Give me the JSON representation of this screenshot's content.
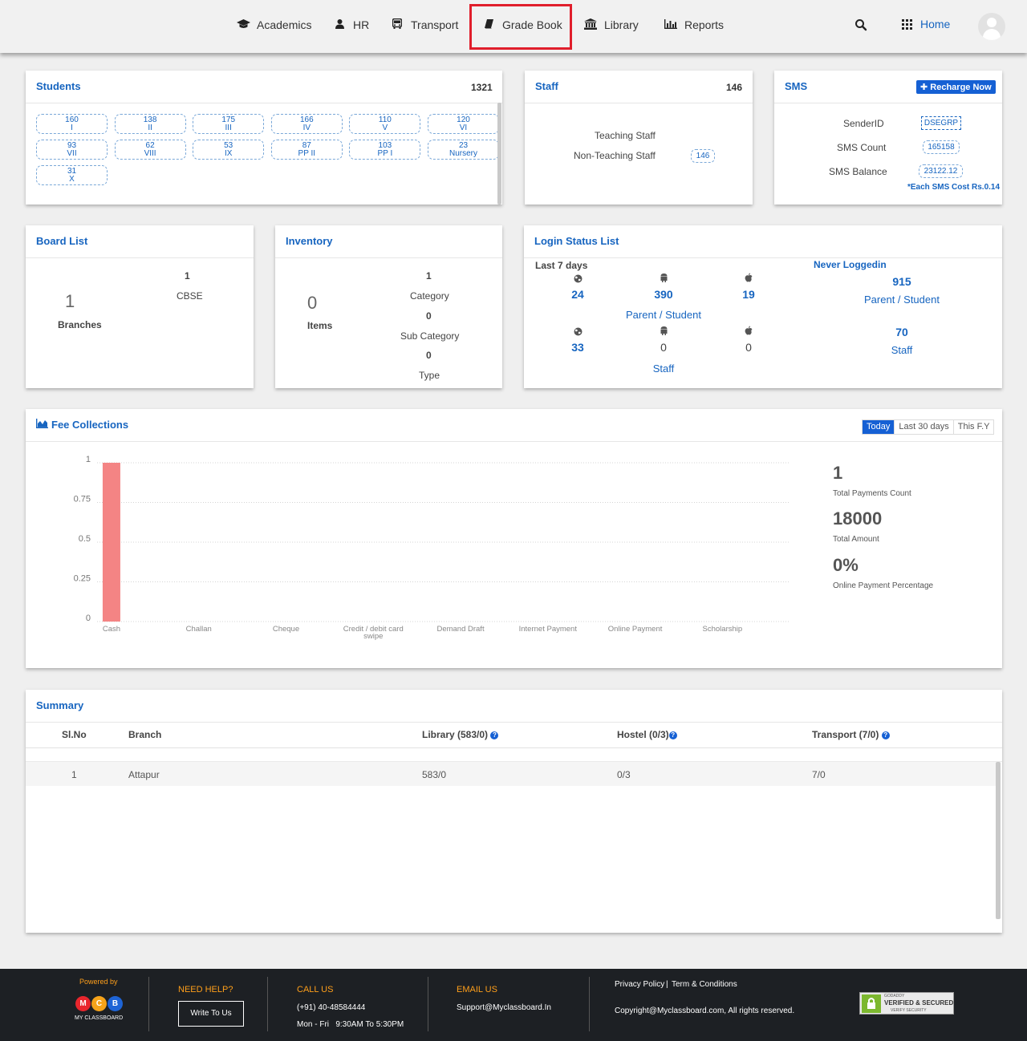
{
  "nav": {
    "items": [
      {
        "label": "Academics",
        "icon": "graduation-cap-icon"
      },
      {
        "label": "HR",
        "icon": "user-icon"
      },
      {
        "label": "Transport",
        "icon": "bus-icon"
      },
      {
        "label": "Grade Book",
        "icon": "book-icon"
      },
      {
        "label": "Library",
        "icon": "institution-icon"
      },
      {
        "label": "Reports",
        "icon": "bar-chart-icon"
      }
    ],
    "home_label": "Home",
    "highlight_color": "#e01e2b"
  },
  "students": {
    "title": "Students",
    "total": "1321",
    "classes": [
      {
        "count": "160",
        "name": "I"
      },
      {
        "count": "138",
        "name": "II"
      },
      {
        "count": "175",
        "name": "III"
      },
      {
        "count": "166",
        "name": "IV"
      },
      {
        "count": "110",
        "name": "V"
      },
      {
        "count": "120",
        "name": "VI"
      },
      {
        "count": "93",
        "name": "VII"
      },
      {
        "count": "62",
        "name": "VIII"
      },
      {
        "count": "53",
        "name": "IX"
      },
      {
        "count": "87",
        "name": "PP II"
      },
      {
        "count": "103",
        "name": "PP I"
      },
      {
        "count": "23",
        "name": "Nursery"
      },
      {
        "count": "31",
        "name": "X"
      }
    ]
  },
  "staff": {
    "title": "Staff",
    "total": "146",
    "teaching_label": "Teaching Staff",
    "non_teaching_label": "Non-Teaching Staff",
    "non_teaching_count": "146"
  },
  "sms": {
    "title": "SMS",
    "recharge_label": "Recharge Now",
    "sender_label": "SenderID",
    "sender_value": "DSEGRP",
    "count_label": "SMS Count",
    "count_value": "165158",
    "balance_label": "SMS Balance",
    "balance_value": "23122.12",
    "cost_note": "*Each SMS Cost Rs.0.14"
  },
  "board": {
    "title": "Board List",
    "branches_value": "1",
    "branches_label": "Branches",
    "cbse_value": "1",
    "cbse_label": "CBSE"
  },
  "inventory": {
    "title": "Inventory",
    "items_value": "0",
    "items_label": "Items",
    "category_value": "1",
    "category_label": "Category",
    "subcategory_value": "0",
    "subcategory_label": "Sub Category",
    "type_value": "0",
    "type_label": "Type"
  },
  "login": {
    "title": "Login Status List",
    "last7_label": "Last 7 days",
    "parent_web": "24",
    "parent_android": "390",
    "parent_ios": "19",
    "parent_label": "Parent / Student",
    "staff_web": "33",
    "staff_android": "0",
    "staff_ios": "0",
    "staff_label": "Staff",
    "never_label": "Never Loggedin",
    "never_parent_value": "915",
    "never_parent_label": "Parent / Student",
    "never_staff_value": "70",
    "never_staff_label": "Staff"
  },
  "fees": {
    "title": "Fee Collections",
    "tabs": [
      "Today",
      "Last 30 days",
      "This F.Y"
    ],
    "payments_count": "1",
    "payments_count_label": "Total Payments Count",
    "total_amount": "18000",
    "total_amount_label": "Total Amount",
    "online_pct": "0%",
    "online_pct_label": "Online Payment Percentage"
  },
  "chart_data": {
    "type": "bar",
    "categories": [
      "Cash",
      "Challan",
      "Cheque",
      "Credit / debit card swipe",
      "Demand Draft",
      "Internet Payment",
      "Online Payment",
      "Scholarship"
    ],
    "values": [
      1,
      0,
      0,
      0,
      0,
      0,
      0,
      0
    ],
    "yticks": [
      "0",
      "0.25",
      "0.5",
      "0.75",
      "1"
    ],
    "ylim": [
      0,
      1
    ],
    "bar_color": "#f48484",
    "grid": true
  },
  "summary": {
    "title": "Summary",
    "columns": [
      "Sl.No",
      "Branch",
      "Library (583/0)",
      "Hostel (0/3)",
      "Transport (7/0)"
    ],
    "rows": [
      {
        "slno": "1",
        "branch": "Attapur",
        "library": "583/0",
        "hostel": "0/3",
        "transport": "7/0"
      }
    ]
  },
  "footer": {
    "powered_by": "Powered by",
    "brand": "MY CLASSBOARD",
    "need_help": "NEED HELP?",
    "write_label": "Write To Us",
    "call_us": "CALL US",
    "phone": "(+91) 40-48584444",
    "hours": "Mon - Fri   9:30AM To 5:30PM",
    "email_us": "EMAIL US",
    "email": "Support@Myclassboard.In",
    "privacy": "Privacy Policy",
    "terms": "Term & Conditions",
    "copyright": "Copyright@Myclassboard.com, All rights reserved.",
    "badge_top": "GODADDY",
    "badge_main": "VERIFIED & SECURED",
    "badge_sub": "VERIFY SECURITY"
  }
}
